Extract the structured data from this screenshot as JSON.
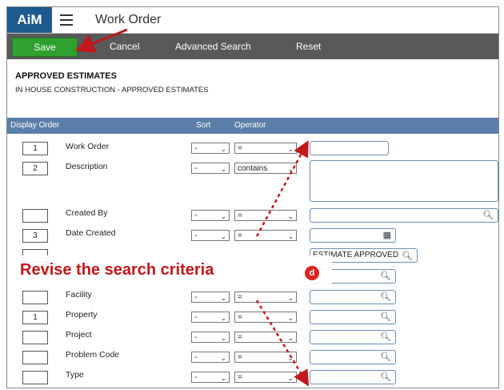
{
  "app": {
    "logo": "AiM",
    "title": "Work Order"
  },
  "toolbar": {
    "save": "Save",
    "cancel": "Cancel",
    "advanced_search": "Advanced Search",
    "reset": "Reset"
  },
  "section": {
    "title": "APPROVED ESTIMATES",
    "subtitle": "IN HOUSE CONSTRUCTION - APPROVED ESTIMATES"
  },
  "grid_headers": {
    "display_order": "Display Order",
    "sort": "Sort",
    "operator": "Operator"
  },
  "rows": [
    {
      "order": "1",
      "label": "Work Order",
      "sort": "-",
      "operator": "=",
      "value": ""
    },
    {
      "order": "2",
      "label": "Description",
      "sort": "-",
      "operator": "contains",
      "value": ""
    },
    {
      "order": "",
      "label": "Created By",
      "sort": "-",
      "operator": "=",
      "value": ""
    },
    {
      "order": "3",
      "label": "Date Created",
      "sort": "-",
      "operator": "=",
      "value": ""
    },
    {
      "order": "",
      "label": "",
      "sort": "-",
      "operator": "=",
      "value": "ESTIMATE APPROVED"
    },
    {
      "order": "",
      "label": "",
      "sort": "-",
      "operator": "=",
      "value": ""
    },
    {
      "order": "",
      "label": "Facility",
      "sort": "-",
      "operator": "=",
      "value": ""
    },
    {
      "order": "1",
      "label": "Property",
      "sort": "-",
      "operator": "=",
      "value": ""
    },
    {
      "order": "",
      "label": "Project",
      "sort": "-",
      "operator": "=",
      "value": ""
    },
    {
      "order": "",
      "label": "Problem Code",
      "sort": "-",
      "operator": "=",
      "value": ""
    },
    {
      "order": "",
      "label": "Type",
      "sort": "-",
      "operator": "=",
      "value": ""
    }
  ],
  "annotation": {
    "text": "Revise the search criteria",
    "badge": "d"
  },
  "icons": {
    "menu": "hamburger-icon",
    "search": "magnifier-icon",
    "calendar": "calendar-icon",
    "dropdown": "chevron-down-icon"
  },
  "colors": {
    "logo_bg": "#1f5a8e",
    "toolbar_bg": "#595959",
    "save_bg": "#2ea02e",
    "grid_header_bg": "#5b7fa8",
    "annotation_red": "#c0181b"
  }
}
